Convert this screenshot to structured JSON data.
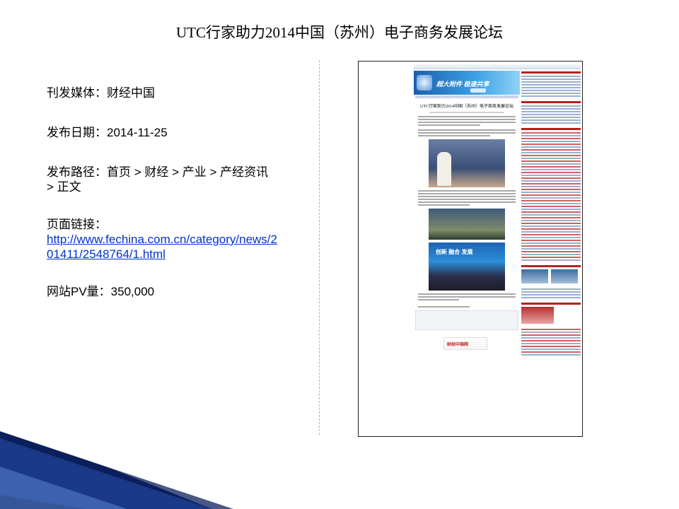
{
  "slide": {
    "title": "UTC行家助力2014中国（苏州）电子商务发展论坛",
    "media_line": "刊发媒体：财经中国",
    "date_line": "发布日期：2014-11-25",
    "path_line1": "发布路径：首页 > 财经 > 产业 > 产经资讯",
    "path_line2": "> 正文",
    "link_label": "页面链接：",
    "link_line1": "http://www.fechina.com.cn/category/news/2",
    "link_line2": "01411/2548764/1.html",
    "pv_line": "网站PV量：350,000"
  },
  "screenshot": {
    "banner_big": "超大附件 极速共享",
    "article_title": "UTC行家助力2014中国（苏州）电子商务发展论坛",
    "photo3_text": "创新 融合 发展",
    "logo_text": "财经中国网"
  },
  "colors": {
    "link": "#0033cc",
    "deco_navy": "#0b1f5c",
    "deco_blue": "#3c6ec6"
  }
}
